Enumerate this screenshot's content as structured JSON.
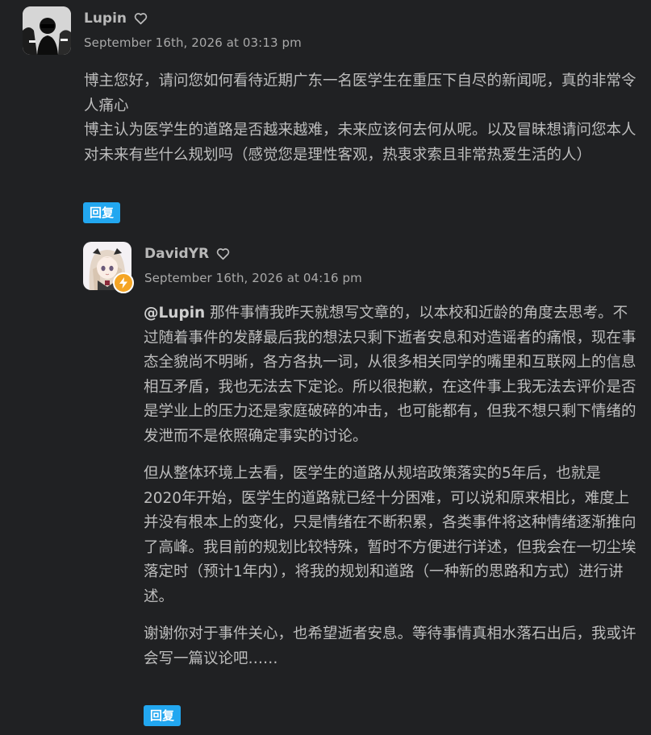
{
  "comments": [
    {
      "author": "Lupin",
      "date": "September 16th, 2026 at 03:13 pm",
      "paragraphs": [
        "博主您好，请问您如何看待近期广东一名医学生在重压下自尽的新闻呢，真的非常令人痛心",
        "博主认为医学生的道路是否越来越难，未来应该何去何从呢。以及冒昧想请问您本人对未来有些什么规划吗（感觉您是理性客观，热衷求索且非常热爱生活的人）"
      ],
      "reply_label": "回复",
      "avatar_icon": "bw-photo-avatar"
    },
    {
      "author": "DavidYR",
      "date": "September 16th, 2026 at 04:16 pm",
      "mention": "@Lupin",
      "paragraphs": [
        " 那件事情我昨天就想写文章的，以本校和近龄的角度去思考。不过随着事件的发酵最后我的想法只剩下逝者安息和对造谣者的痛恨，现在事态全貌尚不明晰，各方各执一词，从很多相关同学的嘴里和互联网上的信息相互矛盾，我也无法去下定论。所以很抱歉，在这件事上我无法去评价是否是学业上的压力还是家庭破碎的冲击，也可能都有，但我不想只剩下情绪的发泄而不是依照确定事实的讨论。",
        "但从整体环境上去看，医学生的道路从规培政策落实的5年后，也就是2020年开始，医学生的道路就已经十分困难，可以说和原来相比，难度上并没有根本上的变化，只是情绪在不断积累，各类事件将这种情绪逐渐推向了高峰。我目前的规划比较特殊，暂时不方便进行详述，但我会在一切尘埃落定时（预计1年内），将我的规划和道路（一种新的思路和方式）进行讲述。",
        "谢谢你对于事件关心，也希望逝者安息。等待事情真相水落石出后，我或许会写一篇议论吧……"
      ],
      "reply_label": "回复",
      "avatar_icon": "anime-girl-avatar",
      "badge_icon": "lightning-icon"
    }
  ],
  "colors": {
    "background": "#202123",
    "reply_button": "#22a7f0",
    "badge": "#f5a524"
  }
}
